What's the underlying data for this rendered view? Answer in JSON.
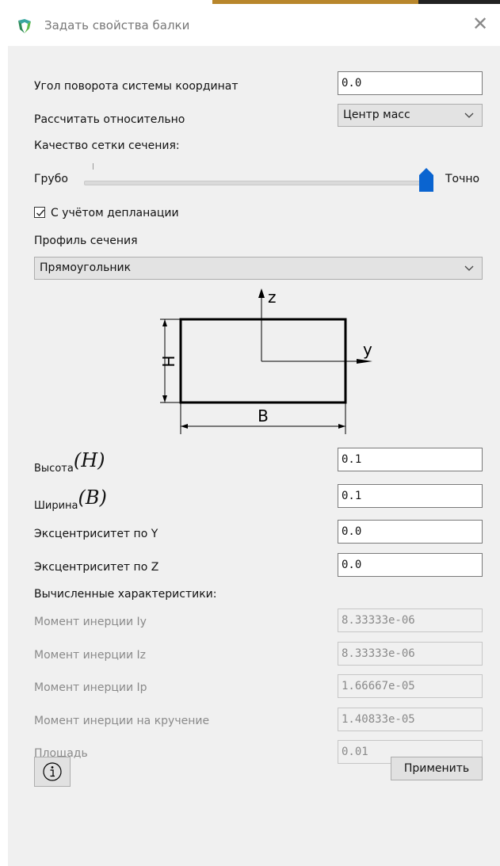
{
  "window": {
    "title": "Задать свойства балки",
    "close_icon": "close-icon",
    "app_icon": "app-logo-icon"
  },
  "form": {
    "rotation_label": "Угол поворота системы координат",
    "rotation_value": "0.0",
    "relative_label": "Рассчитать относительно",
    "relative_value": "Центр масс",
    "mesh_label": "Качество сетки сечения:",
    "mesh_min": "Грубо",
    "mesh_max": "Точно",
    "mesh_level": 1.0,
    "warping_label": "С учётом депланации",
    "warping_checked": true,
    "profile_label": "Профиль сечения",
    "profile_value": "Прямоугольник",
    "height_label": "Высота",
    "height_symbol": "(H)",
    "height_value": "0.1",
    "width_label": "Ширина",
    "width_symbol": "(B)",
    "width_value": "0.1",
    "ecc_y_label": "Эксцентриситет по Y",
    "ecc_y_value": "0.0",
    "ecc_z_label": "Эксцентриситет по Z",
    "ecc_z_value": "0.0"
  },
  "diagram": {
    "axis_z": "z",
    "axis_y": "y",
    "dim_h": "H",
    "dim_b": "B"
  },
  "computed": {
    "header": "Вычисленные характеристики:",
    "rows": [
      {
        "label": "Момент инерции Iy",
        "value": "8.33333e-06"
      },
      {
        "label": "Момент инерции Iz",
        "value": "8.33333e-06"
      },
      {
        "label": "Момент инерции Ip",
        "value": "1.66667e-05"
      },
      {
        "label": "Момент инерции на кручение",
        "value": "1.40833e-05"
      },
      {
        "label": "Площадь",
        "value": "0.01"
      }
    ]
  },
  "buttons": {
    "info_icon": "info-icon",
    "apply_label": "Применить"
  },
  "colors": {
    "slider_thumb": "#0a64d0",
    "panel_bg": "#f0f0f0"
  }
}
